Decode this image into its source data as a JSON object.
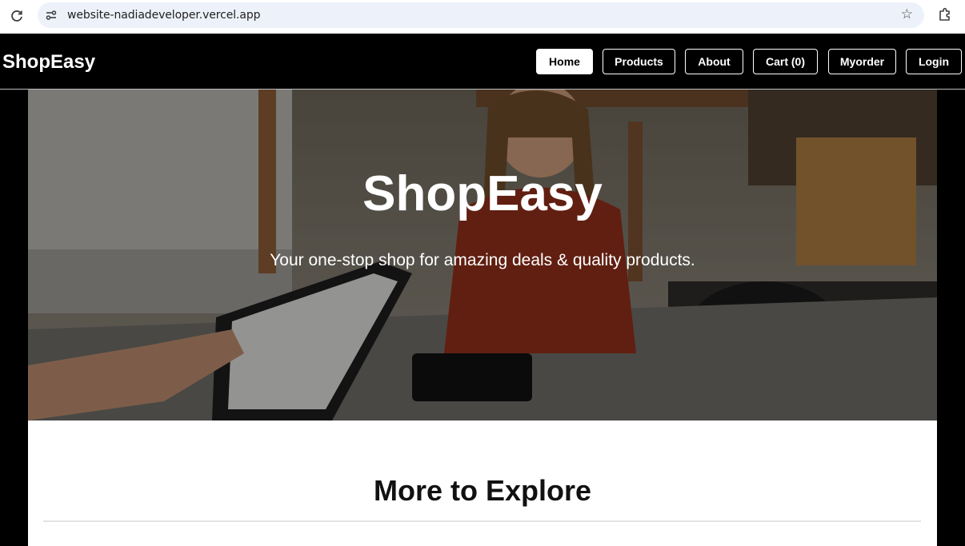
{
  "browser": {
    "url": "website-nadiadeveloper.vercel.app",
    "icons": {
      "reload": "reload-icon",
      "site_info": "site-info-icon",
      "bookmark": "star-icon",
      "extensions": "puzzle-icon"
    }
  },
  "navbar": {
    "brand": "ShopEasy",
    "items": [
      {
        "label": "Home",
        "active": true
      },
      {
        "label": "Products",
        "active": false
      },
      {
        "label": "About",
        "active": false
      },
      {
        "label": "Cart (0)",
        "active": false
      },
      {
        "label": "Myorder",
        "active": false
      },
      {
        "label": "Login",
        "active": false
      }
    ]
  },
  "hero": {
    "title": "ShopEasy",
    "subtitle": "Your one-stop shop for amazing deals & quality products."
  },
  "section": {
    "title": "More to Explore"
  },
  "colors": {
    "page_background": "#000000",
    "navbar_background": "#000000",
    "active_button_background": "#ffffff",
    "content_background": "#ffffff"
  }
}
